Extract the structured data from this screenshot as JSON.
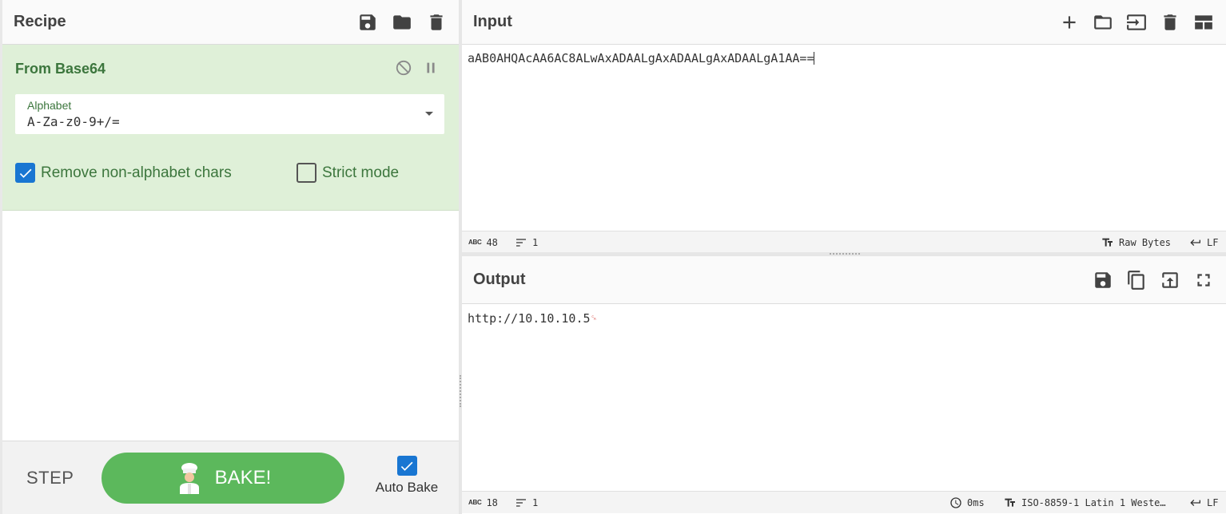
{
  "recipe": {
    "title": "Recipe",
    "operation": {
      "title": "From Base64",
      "alphabet_label": "Alphabet",
      "alphabet_value": "A-Za-z0-9+/=",
      "remove_non_alphabet_label": "Remove non-alphabet chars",
      "remove_non_alphabet_checked": true,
      "strict_mode_label": "Strict mode",
      "strict_mode_checked": false
    },
    "controls": {
      "step_label": "STEP",
      "bake_label": "BAKE!",
      "auto_bake_label": "Auto Bake",
      "auto_bake_checked": true
    }
  },
  "input": {
    "title": "Input",
    "text": "aAB0AHQAcAA6AC8ALwAxADAALgAxADAALgAxADAALgA1AA==",
    "status": {
      "length": "48",
      "lines": "1",
      "encoding": "Raw Bytes",
      "eol": "LF"
    }
  },
  "output": {
    "title": "Output",
    "text": "http://10.10.10.5",
    "status": {
      "length": "18",
      "lines": "1",
      "time": "0ms",
      "encoding": "ISO-8859-1 Latin 1 Weste…",
      "eol": "LF"
    }
  },
  "colors": {
    "accent_green": "#5cb85c",
    "op_background": "#dff0d8",
    "checkbox_blue": "#1976d2"
  }
}
